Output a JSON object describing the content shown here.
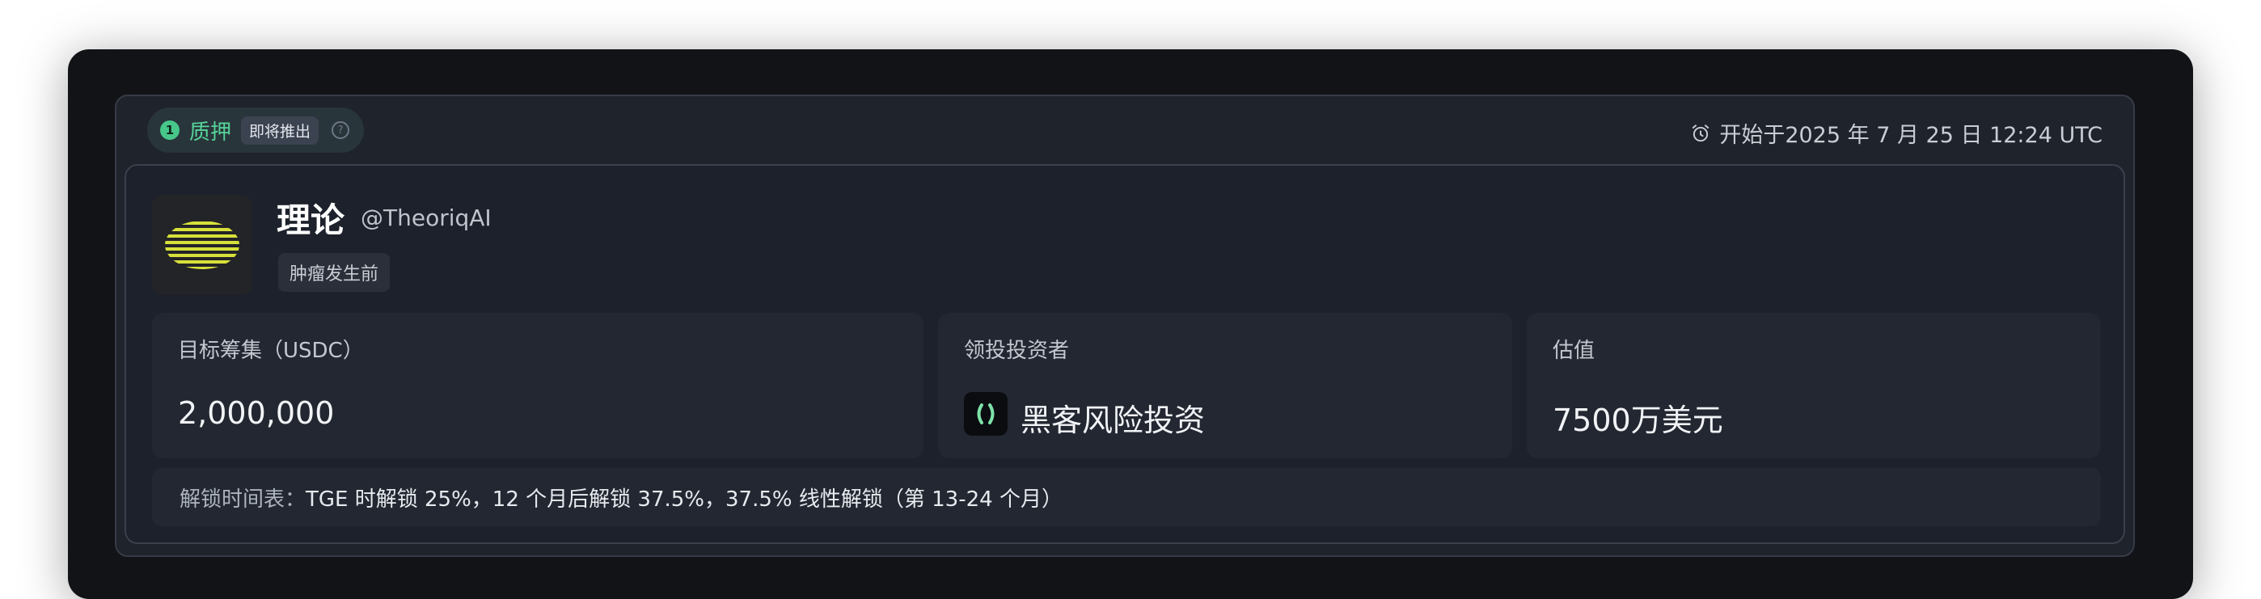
{
  "status": {
    "step_number": "1",
    "label": "质押",
    "badge": "即将推出",
    "help_glyph": "?"
  },
  "schedule": {
    "start_text": "开始于2025 年 7 月 25 日 12:24 UTC"
  },
  "project": {
    "name": "理论",
    "handle": "@TheoriqAI",
    "stage": "肿瘤发生前",
    "logo_color": "#d7e03a"
  },
  "stats": {
    "target": {
      "label": "目标筹集（USDC）",
      "value": "2,000,000"
    },
    "lead_investor": {
      "label": "领投投资者",
      "name": "黑客风险投资",
      "logo_color": "#7ee2a8"
    },
    "valuation": {
      "label": "估值",
      "value": "7500万美元"
    }
  },
  "vesting": {
    "label": "解锁时间表：",
    "value": "TGE 时解锁 25%，12 个月后解锁 37.5%，37.5% 线性解锁（第 13-24 个月）"
  },
  "colors": {
    "accent_green": "#56d49a",
    "window_bg": "#111317",
    "card_bg": "#1f232b"
  }
}
